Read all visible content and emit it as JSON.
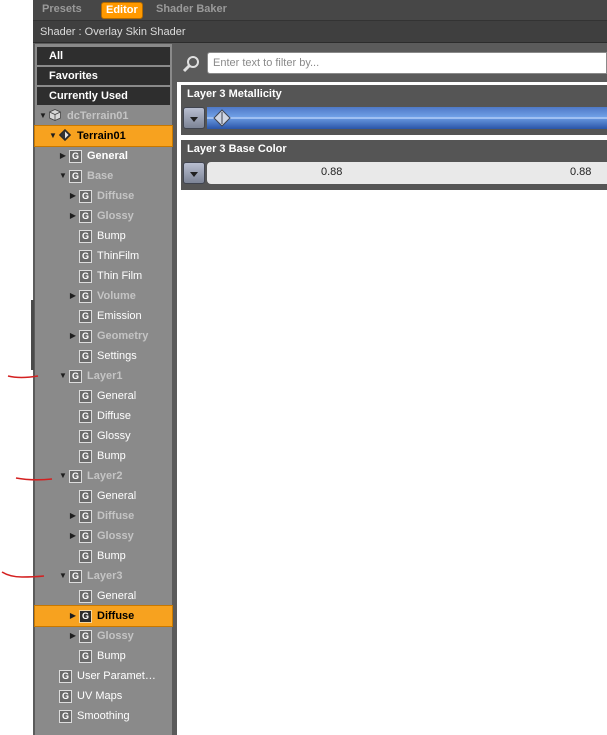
{
  "tabs": {
    "presets": "Presets",
    "editor": "Editor",
    "shader_baker": "Shader Baker"
  },
  "shader_title": "Shader : Overlay Skin Shader",
  "categories": {
    "all": "All",
    "favorites": "Favorites",
    "currently_used": "Currently Used"
  },
  "tree": [
    {
      "label": "dcTerrain01",
      "level": 0,
      "arrow": "down",
      "icon": "figure-icon",
      "bold": true,
      "dim": true,
      "selected": false
    },
    {
      "label": "Terrain01",
      "level": 1,
      "arrow": "down",
      "icon": "surface-node-icon",
      "bold": true,
      "dim": false,
      "selected": true
    },
    {
      "label": "General",
      "level": 2,
      "arrow": "right",
      "icon": "group-icon",
      "bold": true,
      "dim": false,
      "selected": false
    },
    {
      "label": "Base",
      "level": 2,
      "arrow": "down",
      "icon": "group-icon",
      "bold": true,
      "dim": true,
      "selected": false
    },
    {
      "label": "Diffuse",
      "level": 3,
      "arrow": "right",
      "icon": "group-icon",
      "bold": true,
      "dim": true,
      "selected": false
    },
    {
      "label": "Glossy",
      "level": 3,
      "arrow": "right",
      "icon": "group-icon",
      "bold": true,
      "dim": true,
      "selected": false
    },
    {
      "label": "Bump",
      "level": 3,
      "arrow": "",
      "icon": "group-icon",
      "bold": false,
      "dim": false,
      "selected": false
    },
    {
      "label": "ThinFilm",
      "level": 3,
      "arrow": "",
      "icon": "group-icon",
      "bold": false,
      "dim": false,
      "selected": false
    },
    {
      "label": "Thin Film",
      "level": 3,
      "arrow": "",
      "icon": "group-icon",
      "bold": false,
      "dim": false,
      "selected": false
    },
    {
      "label": "Volume",
      "level": 3,
      "arrow": "right",
      "icon": "group-icon",
      "bold": true,
      "dim": true,
      "selected": false
    },
    {
      "label": "Emission",
      "level": 3,
      "arrow": "",
      "icon": "group-icon",
      "bold": false,
      "dim": false,
      "selected": false
    },
    {
      "label": "Geometry",
      "level": 3,
      "arrow": "right",
      "icon": "group-icon",
      "bold": true,
      "dim": true,
      "selected": false
    },
    {
      "label": "Settings",
      "level": 3,
      "arrow": "",
      "icon": "group-icon",
      "bold": false,
      "dim": false,
      "selected": false
    },
    {
      "label": "Layer1",
      "level": 2,
      "arrow": "down",
      "icon": "group-icon",
      "bold": true,
      "dim": true,
      "selected": false
    },
    {
      "label": "General",
      "level": 3,
      "arrow": "",
      "icon": "group-icon",
      "bold": false,
      "dim": false,
      "selected": false
    },
    {
      "label": "Diffuse",
      "level": 3,
      "arrow": "",
      "icon": "group-icon",
      "bold": false,
      "dim": false,
      "selected": false
    },
    {
      "label": "Glossy",
      "level": 3,
      "arrow": "",
      "icon": "group-icon",
      "bold": false,
      "dim": false,
      "selected": false
    },
    {
      "label": "Bump",
      "level": 3,
      "arrow": "",
      "icon": "group-icon",
      "bold": false,
      "dim": false,
      "selected": false
    },
    {
      "label": "Layer2",
      "level": 2,
      "arrow": "down",
      "icon": "group-icon",
      "bold": true,
      "dim": true,
      "selected": false
    },
    {
      "label": "General",
      "level": 3,
      "arrow": "",
      "icon": "group-icon",
      "bold": false,
      "dim": false,
      "selected": false
    },
    {
      "label": "Diffuse",
      "level": 3,
      "arrow": "right",
      "icon": "group-icon",
      "bold": true,
      "dim": true,
      "selected": false
    },
    {
      "label": "Glossy",
      "level": 3,
      "arrow": "right",
      "icon": "group-icon",
      "bold": true,
      "dim": true,
      "selected": false
    },
    {
      "label": "Bump",
      "level": 3,
      "arrow": "",
      "icon": "group-icon",
      "bold": false,
      "dim": false,
      "selected": false
    },
    {
      "label": "Layer3",
      "level": 2,
      "arrow": "down",
      "icon": "group-icon",
      "bold": true,
      "dim": true,
      "selected": false
    },
    {
      "label": "General",
      "level": 3,
      "arrow": "",
      "icon": "group-icon",
      "bold": false,
      "dim": false,
      "selected": false
    },
    {
      "label": "Diffuse",
      "level": 3,
      "arrow": "right",
      "icon": "group-icon",
      "bold": true,
      "dim": false,
      "selected": true
    },
    {
      "label": "Glossy",
      "level": 3,
      "arrow": "right",
      "icon": "group-icon",
      "bold": true,
      "dim": true,
      "selected": false
    },
    {
      "label": "Bump",
      "level": 3,
      "arrow": "",
      "icon": "group-icon",
      "bold": false,
      "dim": false,
      "selected": false
    },
    {
      "label": "User Paramet…",
      "level": 1,
      "arrow": "",
      "icon": "group-icon",
      "bold": false,
      "dim": false,
      "selected": false
    },
    {
      "label": "UV Maps",
      "level": 1,
      "arrow": "",
      "icon": "group-icon",
      "bold": false,
      "dim": false,
      "selected": false
    },
    {
      "label": "Smoothing",
      "level": 1,
      "arrow": "",
      "icon": "group-icon",
      "bold": false,
      "dim": false,
      "selected": false
    }
  ],
  "group_icon_glyph": "G",
  "filter": {
    "placeholder": "Enter text to filter by..."
  },
  "properties": [
    {
      "title": "Layer 3 Metallicity",
      "kind": "slider"
    },
    {
      "title": "Layer 3 Base Color",
      "kind": "color",
      "values": [
        "0.88",
        "0.88"
      ]
    }
  ],
  "colors": {
    "accent": "#ff9900",
    "selection": "#f7a21f",
    "slider_blue": "#5b8fdd",
    "annotation_red": "#d42020"
  }
}
